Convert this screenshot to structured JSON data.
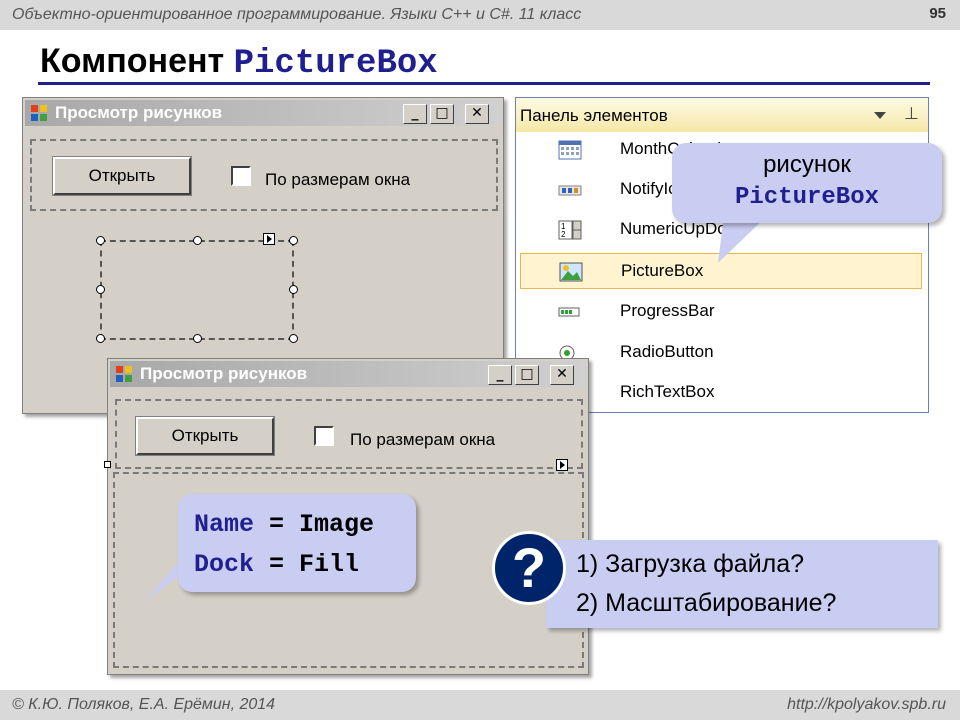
{
  "slide": {
    "course": "Объектно-ориентированное программирование. Языки С++ и С#. 11 класс",
    "page_number": "95",
    "title_prefix": "Компонент",
    "title_component": "PictureBox",
    "authors": "© К.Ю. Поляков, Е.А. Ерёмин, 2014",
    "url": "http://kpolyakov.spb.ru"
  },
  "form": {
    "title": "Просмотр рисунков",
    "minimize": "_",
    "maximize": "□",
    "close": "✕",
    "open_button": "Открыть",
    "fit_checkbox_label": "По размерам окна",
    "fit_checked": false
  },
  "toolbox": {
    "title": "Панель элементов",
    "items": [
      {
        "label": "MonthCalendar",
        "icon": "calendar-icon"
      },
      {
        "label": "NotifyIcon",
        "icon": "notify-icon"
      },
      {
        "label": "NumericUpDown",
        "icon": "numeric-updown-icon"
      },
      {
        "label": "PictureBox",
        "icon": "picture-icon",
        "selected": true
      },
      {
        "label": "ProgressBar",
        "icon": "progressbar-icon"
      },
      {
        "label": "RadioButton",
        "icon": "radio-icon"
      },
      {
        "label": "RichTextBox",
        "icon": "richtext-icon"
      }
    ]
  },
  "callouts": {
    "picture_word": "рисунок",
    "picture_component": "PictureBox",
    "name_key": "Name",
    "name_value": "= Image",
    "dock_key": "Dock",
    "dock_value": "= Fill"
  },
  "questions": {
    "mark": "?",
    "q1": "1) Загрузка файла?",
    "q2": "2) Масштабирование?"
  },
  "colors": {
    "accent": "#1f1f8f",
    "callout_bg": "#c9cdf2",
    "question_circle": "#00246a",
    "form_bg": "#d4d0c8"
  }
}
